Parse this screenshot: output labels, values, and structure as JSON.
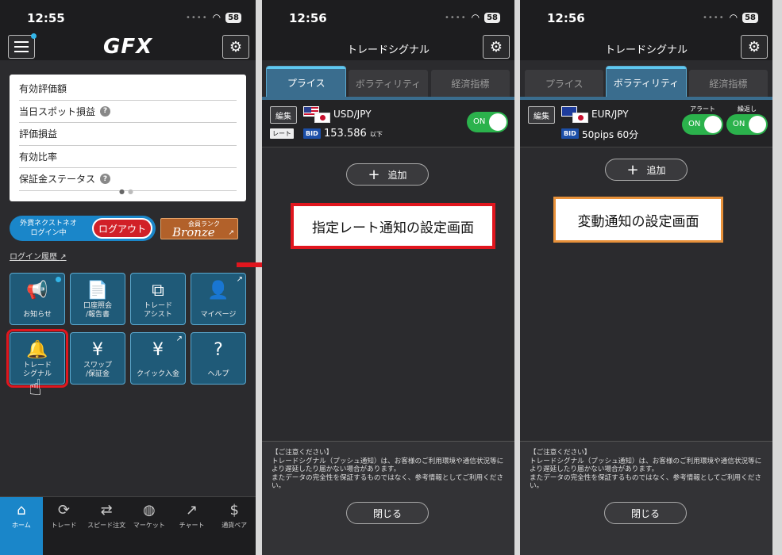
{
  "status": {
    "time1": "12:55",
    "time2": "12:56",
    "time3": "12:56",
    "battery": "58"
  },
  "colors": {
    "accent": "#1a86c9",
    "logout": "#d12027",
    "toggle_on": "#2bb24c",
    "callout_red": "#e0161e",
    "callout_orange": "#e8913a"
  },
  "home": {
    "logo": "GFX",
    "summary_rows": [
      {
        "label": "有効評価額",
        "help": false
      },
      {
        "label": "当日スポット損益",
        "help": true
      },
      {
        "label": "評価損益",
        "help": false
      },
      {
        "label": "有効比率",
        "help": false
      },
      {
        "label": "保証金ステータス",
        "help": true
      }
    ],
    "login_text_1": "外貨ネクストネオ",
    "login_text_2": "ログイン中",
    "logout_label": "ログアウト",
    "rank_label": "会員ランク",
    "rank_value": "Bronze",
    "login_history": "ログイン履歴",
    "tiles": [
      {
        "label": "お知らせ",
        "icon": "megaphone-icon",
        "glyph": "📢"
      },
      {
        "label": "口座照会\n/報告書",
        "icon": "report-icon",
        "glyph": "📄"
      },
      {
        "label": "トレード\nアシスト",
        "icon": "trade-assist-icon",
        "glyph": "⧉"
      },
      {
        "label": "マイページ",
        "icon": "person-icon",
        "glyph": "👤"
      },
      {
        "label": "トレード\nシグナル",
        "icon": "bell-icon",
        "glyph": "🔔"
      },
      {
        "label": "スワップ\n/保証金",
        "icon": "swap-coin-icon",
        "glyph": "¥"
      },
      {
        "label": "クイック入金",
        "icon": "quick-deposit-icon",
        "glyph": "¥"
      },
      {
        "label": "ヘルプ",
        "icon": "help-icon",
        "glyph": "?"
      }
    ],
    "tabbar": [
      {
        "label": "ホーム",
        "icon": "home-icon",
        "glyph": "⌂"
      },
      {
        "label": "トレード",
        "icon": "trade-icon",
        "glyph": "⟳"
      },
      {
        "label": "スピード注文",
        "icon": "speed-order-icon",
        "glyph": "⇄"
      },
      {
        "label": "マーケット",
        "icon": "globe-icon",
        "glyph": "◍"
      },
      {
        "label": "チャート",
        "icon": "chart-icon",
        "glyph": "↗"
      },
      {
        "label": "通貨ペア",
        "icon": "currency-pair-icon",
        "glyph": "$"
      }
    ]
  },
  "signal": {
    "title": "トレードシグナル",
    "tabs": [
      "プライス",
      "ボラティリティ",
      "経済指標"
    ],
    "edit": "編集",
    "add": "追加",
    "close": "閉じる",
    "price_row": {
      "pair": "USD/JPY",
      "rate_tag": "レート",
      "bid_tag": "BID",
      "rate": "153.586",
      "cond": "以下",
      "toggle": "ON"
    },
    "vol_row": {
      "pair": "EUR/JPY",
      "bid_tag": "BID",
      "detail": "50pips 60分",
      "alert_label": "アラート",
      "repeat_label": "繰返し",
      "toggle1": "ON",
      "toggle2": "ON"
    },
    "callout_price": "指定レート通知の設定画面",
    "callout_vol": "変動通知の設定画面",
    "notice": "【ご注意ください】\nトレードシグナル（プッシュ通知）は、お客様のご利用環境や通信状況等により遅延したり届かない場合があります。\nまたデータの完全性を保証するものではなく、参考情報としてご利用ください。"
  }
}
